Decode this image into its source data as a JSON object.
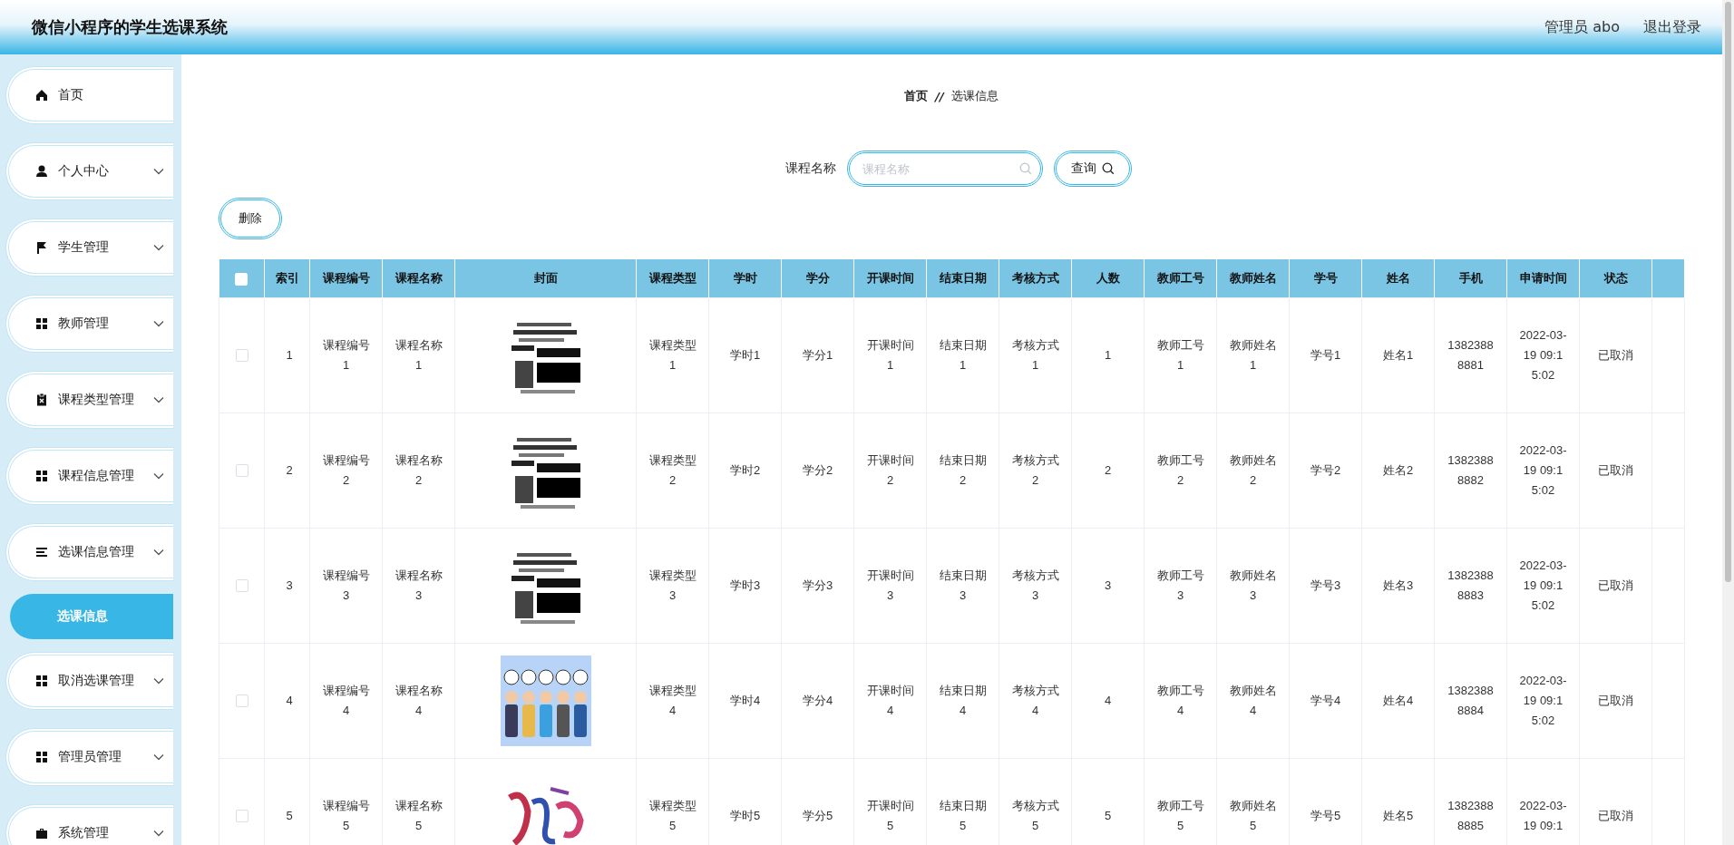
{
  "header": {
    "title": "微信小程序的学生选课系统",
    "user": "管理员 abo",
    "logout": "退出登录"
  },
  "sidebar": {
    "items": [
      {
        "label": "首页",
        "kind": "link"
      },
      {
        "label": "个人中心",
        "kind": "menu"
      },
      {
        "label": "学生管理",
        "kind": "menu"
      },
      {
        "label": "教师管理",
        "kind": "menu"
      },
      {
        "label": "课程类型管理",
        "kind": "menu"
      },
      {
        "label": "课程信息管理",
        "kind": "menu"
      },
      {
        "label": "选课信息管理",
        "kind": "menu",
        "children": [
          {
            "label": "选课信息",
            "selected": true
          }
        ]
      },
      {
        "label": "取消选课管理",
        "kind": "menu"
      },
      {
        "label": "管理员管理",
        "kind": "menu"
      },
      {
        "label": "系统管理",
        "kind": "menu"
      }
    ]
  },
  "breadcrumb": {
    "items": [
      "首页",
      "选课信息"
    ],
    "separator": "//"
  },
  "search": {
    "label": "课程名称",
    "placeholder": "课程名称",
    "button": "查询"
  },
  "delete_button": "删除",
  "table": {
    "all_selected": false,
    "columns": [
      {
        "label": "索引",
        "kind": "text"
      },
      {
        "label": "课程编号",
        "kind": "text"
      },
      {
        "label": "课程名称",
        "kind": "text"
      },
      {
        "label": "封面",
        "kind": "cover"
      },
      {
        "label": "课程类型",
        "kind": "text"
      },
      {
        "label": "学时",
        "kind": "text"
      },
      {
        "label": "学分",
        "kind": "text"
      },
      {
        "label": "开课时间",
        "kind": "text"
      },
      {
        "label": "结束日期",
        "kind": "text"
      },
      {
        "label": "考核方式",
        "kind": "text"
      },
      {
        "label": "人数",
        "kind": "text"
      },
      {
        "label": "教师工号",
        "kind": "text"
      },
      {
        "label": "教师姓名",
        "kind": "text"
      },
      {
        "label": "学号",
        "kind": "text"
      },
      {
        "label": "姓名",
        "kind": "text"
      },
      {
        "label": "手机",
        "kind": "text"
      },
      {
        "label": "申请时间",
        "kind": "text"
      },
      {
        "label": "状态",
        "kind": "text"
      }
    ],
    "rows": [
      {
        "selected": false,
        "cells": [
          "1",
          "课程编号1",
          "课程名称1",
          {
            "kind": "picture"
          },
          "课程类型1",
          "学时1",
          "学分1",
          "开课时间1",
          "结束日期1",
          "考核方式1",
          "1",
          "教师工号1",
          "教师姓名1",
          "学号1",
          "姓名1",
          "13823888881",
          "2022-03-19 09:15:02",
          "已取消"
        ]
      },
      {
        "selected": false,
        "cells": [
          "2",
          "课程编号2",
          "课程名称2",
          {
            "kind": "picture"
          },
          "课程类型2",
          "学时2",
          "学分2",
          "开课时间2",
          "结束日期2",
          "考核方式2",
          "2",
          "教师工号2",
          "教师姓名2",
          "学号2",
          "姓名2",
          "13823888882",
          "2022-03-19 09:15:02",
          "已取消"
        ]
      },
      {
        "selected": false,
        "cells": [
          "3",
          "课程编号3",
          "课程名称3",
          {
            "kind": "picture"
          },
          "课程类型3",
          "学时3",
          "学分3",
          "开课时间3",
          "结束日期3",
          "考核方式3",
          "3",
          "教师工号3",
          "教师姓名3",
          "学号3",
          "姓名3",
          "13823888883",
          "2022-03-19 09:15:02",
          "已取消"
        ]
      },
      {
        "selected": false,
        "cells": [
          "4",
          "课程编号4",
          "课程名称4",
          {
            "kind": "picture"
          },
          "课程类型4",
          "学时4",
          "学分4",
          "开课时间4",
          "结束日期4",
          "考核方式4",
          "4",
          "教师工号4",
          "教师姓名4",
          "学号4",
          "姓名4",
          "13823888884",
          "2022-03-19 09:15:02",
          "已取消"
        ]
      },
      {
        "selected": false,
        "cells": [
          "5",
          "课程编号5",
          "课程名称5",
          {
            "kind": "picture"
          },
          "课程类型5",
          "学时5",
          "学分5",
          "开课时间5",
          "结束日期5",
          "考核方式5",
          "5",
          "教师工号5",
          "教师姓名5",
          "学号5",
          "姓名5",
          "13823888885",
          "2022-03-19 09:1",
          "已取消"
        ]
      }
    ]
  }
}
